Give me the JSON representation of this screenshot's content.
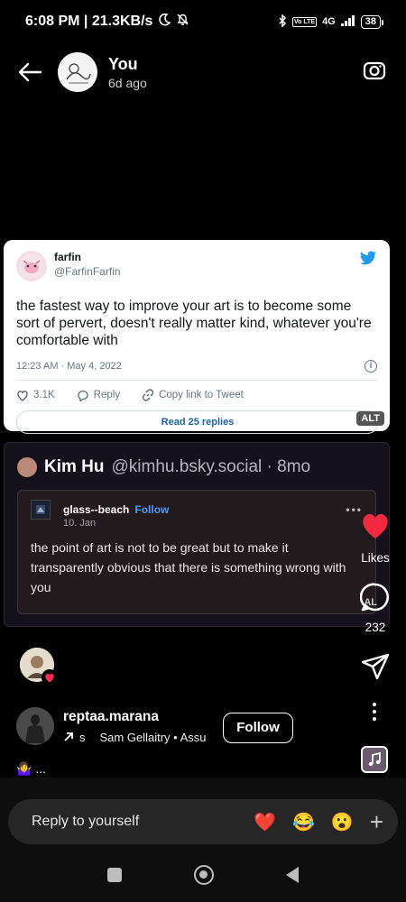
{
  "status_bar": {
    "time_speed": "6:08 PM | 21.3KB/s",
    "network": "4G",
    "volte": "Vo LTE",
    "battery": "38"
  },
  "story": {
    "user": "You",
    "time_ago": "6d ago"
  },
  "tweet": {
    "name": "farfin",
    "handle": "@FarfinFarfin",
    "text": "the fastest way to improve your art is to become some sort of pervert, doesn't really matter kind, whatever you're comfortable with",
    "timestamp": "12:23 AM · May 4, 2022",
    "likes": "3.1K",
    "reply_label": "Reply",
    "copy_label": "Copy link to Tweet",
    "read_replies": "Read 25 replies",
    "alt": "ALT"
  },
  "bsky": {
    "name": "Kim Hu",
    "handle_time": "@kimhu.bsky.social · 8mo",
    "quote": {
      "user": "glass--beach",
      "follow": "Follow",
      "date": "10. Jan",
      "text": "the point of art is not to be great but to make it transparently obvious that there is something wrong with you",
      "alt": "AL"
    }
  },
  "side": {
    "likes_label": "Likes",
    "comment_count": "232"
  },
  "reel": {
    "username": "reptaa.marana",
    "audio_prefix": "s",
    "audio": "Sam Gellaitry • Assu",
    "follow_label": "Follow",
    "caption": "🤷‍♀️ ..."
  },
  "reply": {
    "placeholder": "Reply to yourself",
    "reactions": [
      "❤️",
      "😂",
      "😮"
    ],
    "add": "+"
  },
  "colors": {
    "accent_blue": "#4f9cff",
    "like_red": "#f3293f",
    "twitter_blue": "#1d9bf0"
  }
}
